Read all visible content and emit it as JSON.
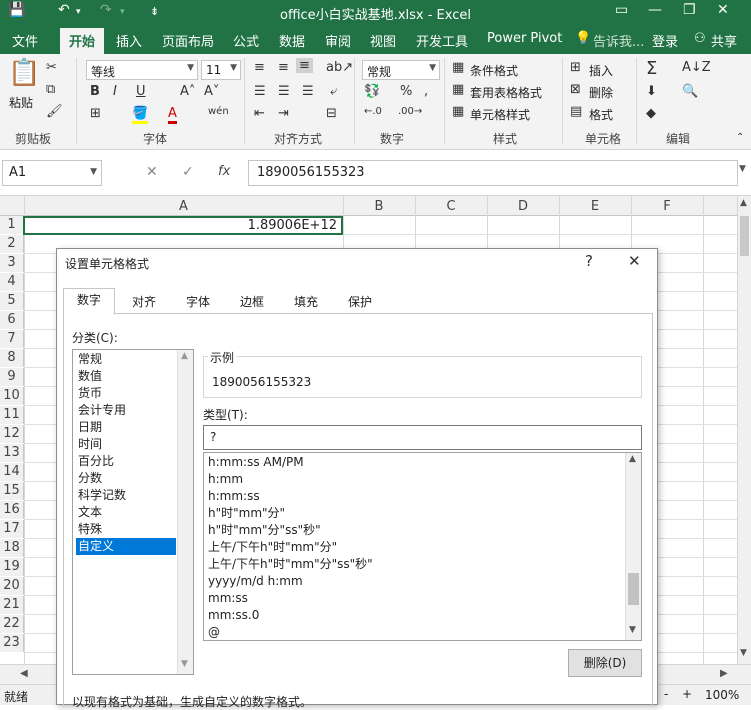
{
  "window": {
    "title": "office小白实战基地.xlsx - Excel"
  },
  "ribbon_tabs": [
    {
      "label": "文件"
    },
    {
      "label": "开始"
    },
    {
      "label": "插入"
    },
    {
      "label": "页面布局"
    },
    {
      "label": "公式"
    },
    {
      "label": "数据"
    },
    {
      "label": "审阅"
    },
    {
      "label": "视图"
    },
    {
      "label": "开发工具"
    },
    {
      "label": "Power Pivot"
    }
  ],
  "tell_me": "告诉我...",
  "login": "登录",
  "share": "共享",
  "ribbon": {
    "clipboard": {
      "paste": "粘贴",
      "group": "剪贴板"
    },
    "font": {
      "name": "等线",
      "size": "11",
      "group": "字体",
      "bold": "B",
      "italic": "I",
      "underline": "U"
    },
    "align": {
      "group": "对齐方式"
    },
    "number": {
      "format": "常规",
      "group": "数字",
      "percent": "%"
    },
    "styles": {
      "cond": "条件格式",
      "table": "套用表格格式",
      "cell": "单元格样式",
      "group": "样式"
    },
    "cells": {
      "insert": "插入",
      "delete": "删除",
      "format": "格式",
      "group": "单元格"
    },
    "editing": {
      "group": "编辑"
    }
  },
  "formula_bar": {
    "name_box": "A1",
    "fx": "fx",
    "cancel": "✕",
    "enter": "✓",
    "content": "1890056155323"
  },
  "grid": {
    "columns": [
      "A",
      "B",
      "C",
      "D",
      "E",
      "F"
    ],
    "rows": [
      "1",
      "2",
      "3",
      "4",
      "5",
      "6",
      "7",
      "8",
      "9",
      "10",
      "11",
      "12",
      "13",
      "14",
      "15",
      "16",
      "17",
      "18",
      "19",
      "20",
      "21",
      "22",
      "23"
    ],
    "a1_value": "1.89006E+12"
  },
  "status": {
    "ready": "就绪",
    "zoom": "100%",
    "minus": "-",
    "plus": "+"
  },
  "dialog": {
    "title": "设置单元格格式",
    "help": "?",
    "close": "✕",
    "tabs": [
      "数字",
      "对齐",
      "字体",
      "边框",
      "填充",
      "保护"
    ],
    "category_label": "分类(C):",
    "categories": [
      "常规",
      "数值",
      "货币",
      "会计专用",
      "日期",
      "时间",
      "百分比",
      "分数",
      "科学记数",
      "文本",
      "特殊",
      "自定义"
    ],
    "selected_category": "自定义",
    "sample_label": "示例",
    "sample_value": "1890056155323",
    "type_label": "类型(T):",
    "type_value": "?",
    "type_list": [
      "h:mm:ss AM/PM",
      "h:mm",
      "h:mm:ss",
      "h\"时\"mm\"分\"",
      "h\"时\"mm\"分\"ss\"秒\"",
      "上午/下午h\"时\"mm\"分\"",
      "上午/下午h\"时\"mm\"分\"ss\"秒\"",
      "yyyy/m/d h:mm",
      "mm:ss",
      "mm:ss.0",
      "@"
    ],
    "delete_button": "删除(D)",
    "hint": "以现有格式为基础，生成自定义的数字格式。"
  },
  "colors": {
    "brand": "#217346",
    "selection": "#0078d7"
  }
}
